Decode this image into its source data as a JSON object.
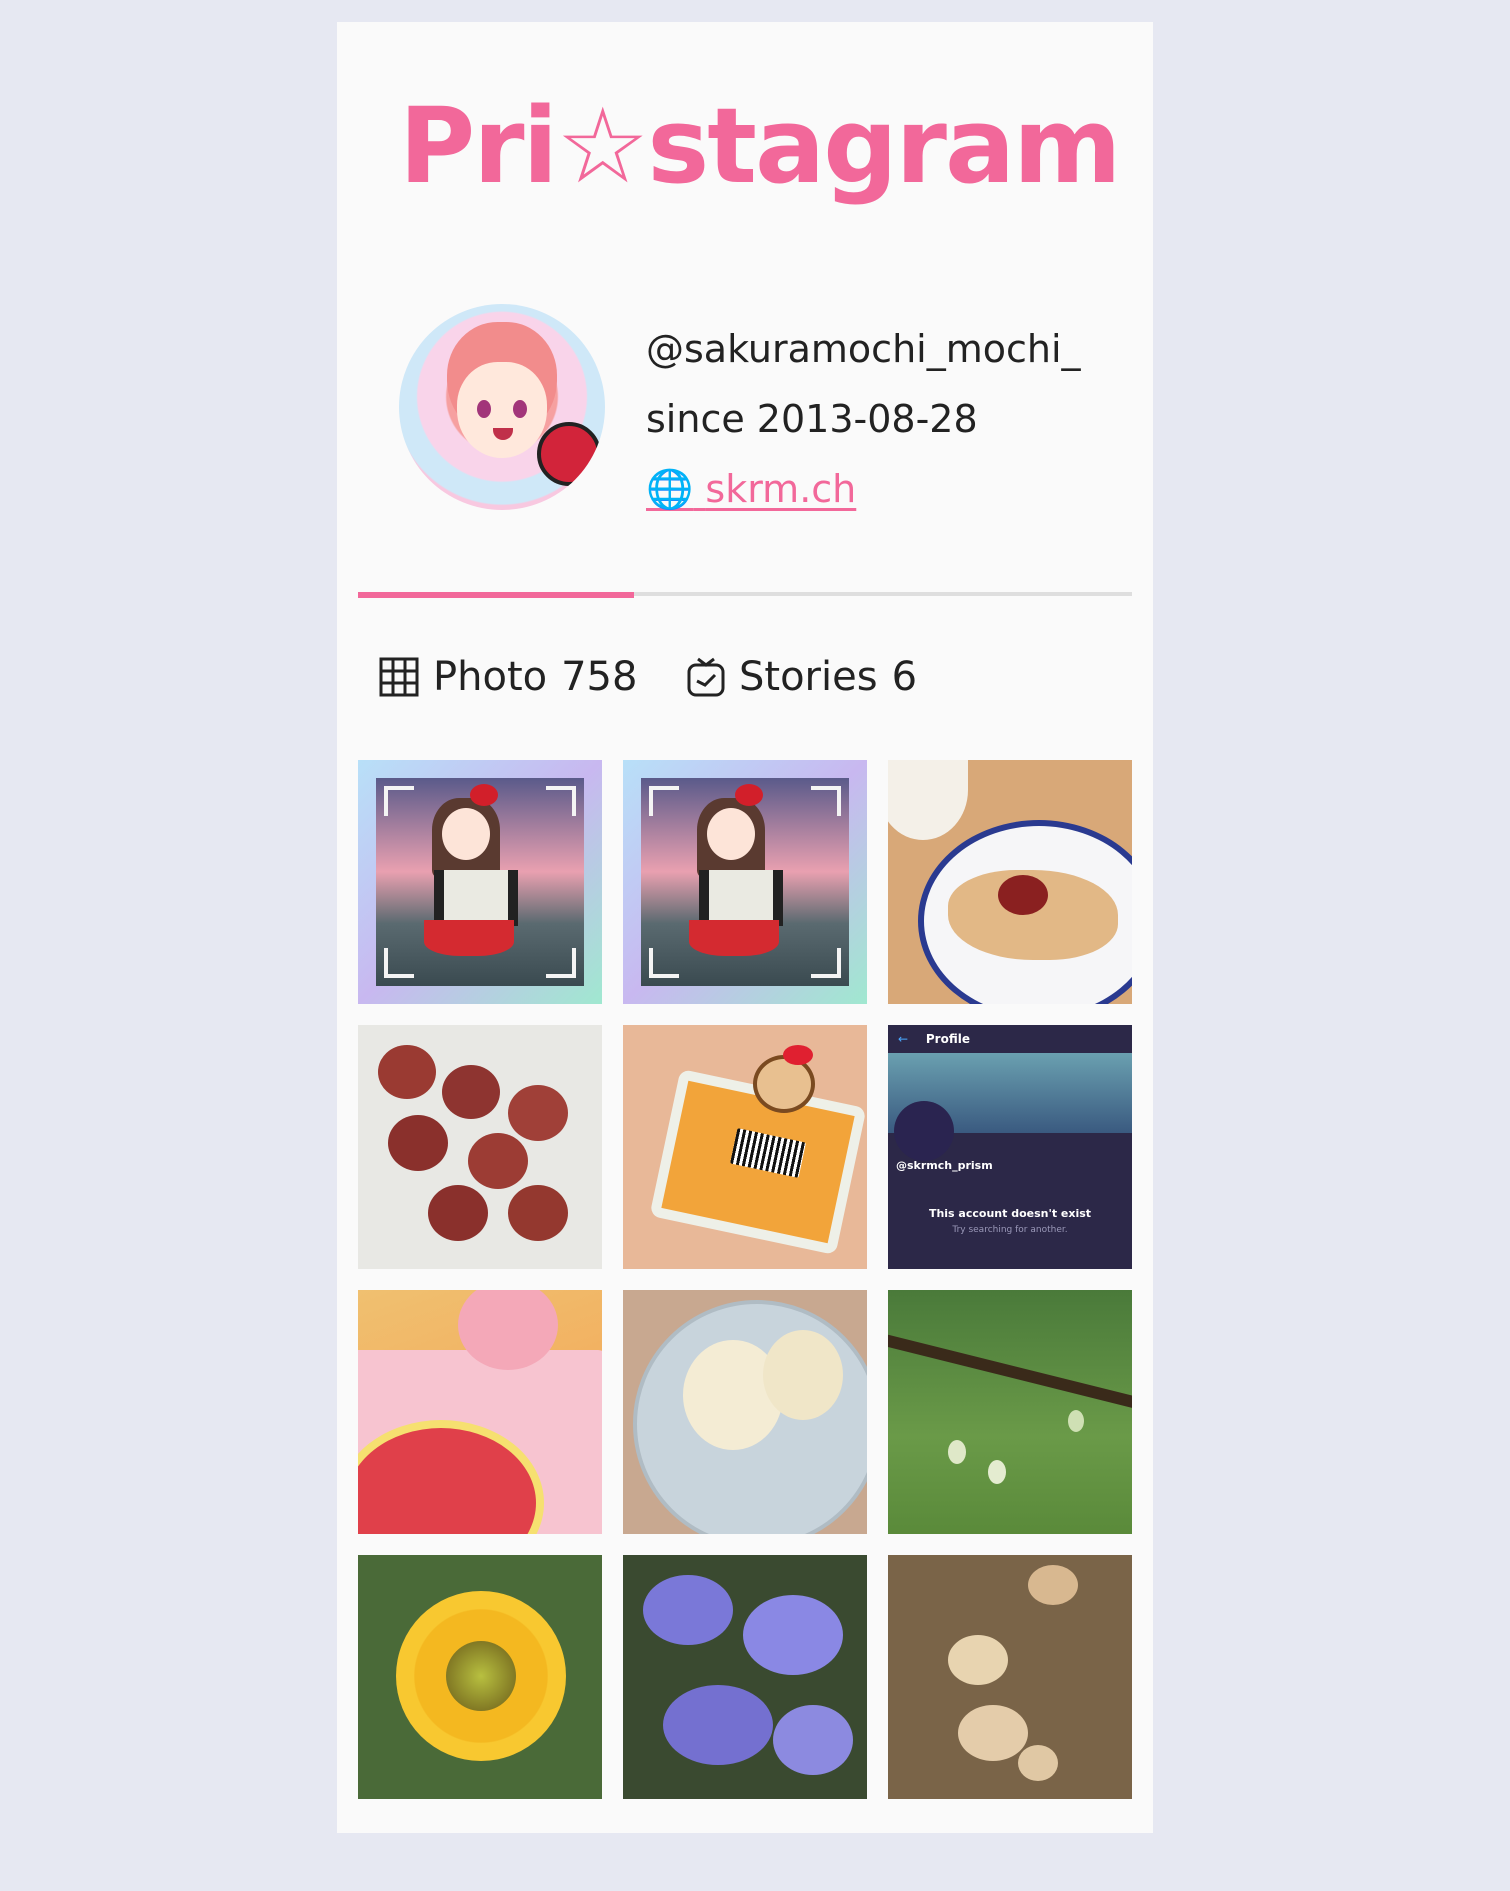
{
  "app": {
    "logo_prefix": "Pri",
    "logo_star": "☆",
    "logo_suffix": "stagram"
  },
  "profile": {
    "handle": "@sakuramochi_mochi_",
    "since": "since 2013-08-28",
    "website_icon": "🌐",
    "website": "skrm.ch"
  },
  "tabs": {
    "photo_label": "Photo",
    "photo_count": "758",
    "stories_label": "Stories",
    "stories_count": "6",
    "active": "photo"
  },
  "screenshot_tile": {
    "title": "Profile",
    "handle": "@skrmch_prism",
    "message": "This account doesn't exist",
    "hint": "Try searching for another."
  },
  "colors": {
    "accent": "#f2689a",
    "background": "#e6e8f2",
    "card": "#fafafa"
  }
}
